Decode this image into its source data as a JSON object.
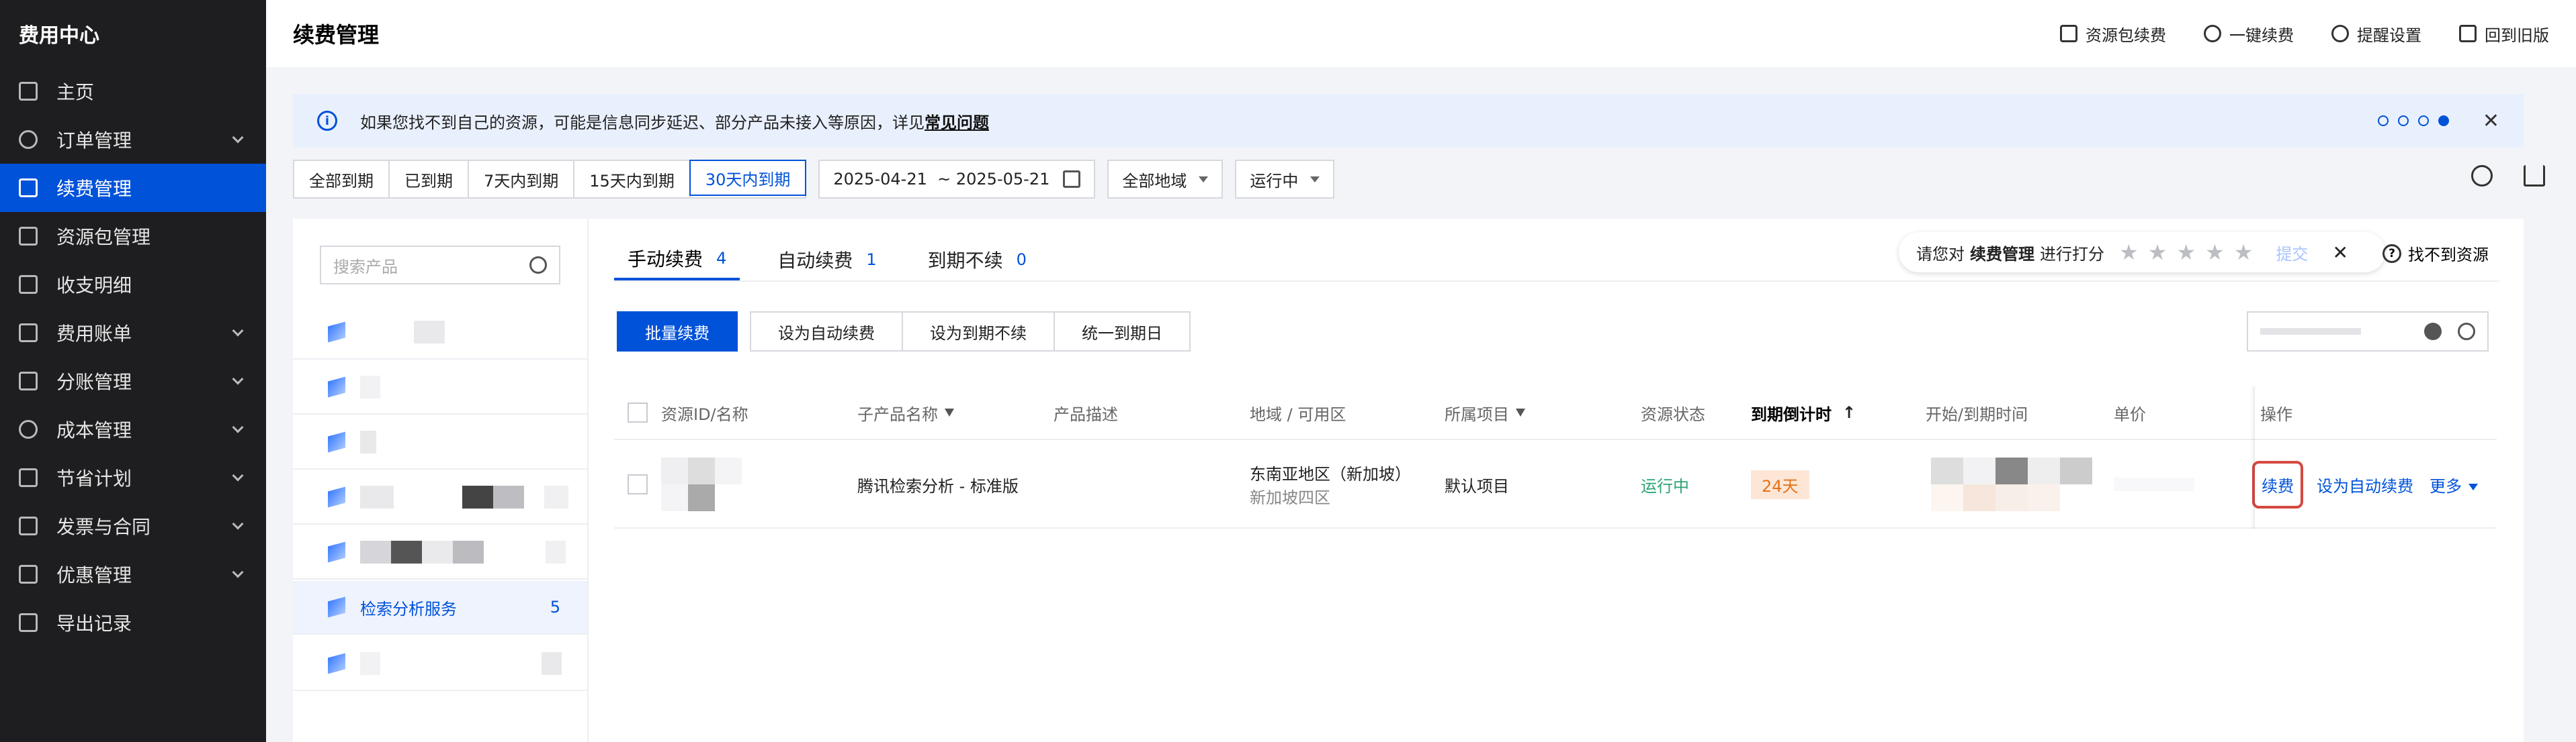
{
  "sidebar": {
    "brand": "费用中心",
    "items": [
      {
        "label": "主页",
        "icon": "dashboard-icon",
        "expandable": false
      },
      {
        "label": "订单管理",
        "icon": "order-icon",
        "expandable": true
      },
      {
        "label": "续费管理",
        "icon": "renew-icon",
        "expandable": false,
        "active": true
      },
      {
        "label": "资源包管理",
        "icon": "package-icon",
        "expandable": false
      },
      {
        "label": "收支明细",
        "icon": "ledger-icon",
        "expandable": false
      },
      {
        "label": "费用账单",
        "icon": "bill-icon",
        "expandable": true
      },
      {
        "label": "分账管理",
        "icon": "split-icon",
        "expandable": true
      },
      {
        "label": "成本管理",
        "icon": "pie-icon",
        "expandable": true
      },
      {
        "label": "节省计划",
        "icon": "plan-icon",
        "expandable": true
      },
      {
        "label": "发票与合同",
        "icon": "invoice-icon",
        "expandable": true
      },
      {
        "label": "优惠管理",
        "icon": "coupon-icon",
        "expandable": true
      },
      {
        "label": "导出记录",
        "icon": "export-icon",
        "expandable": false
      }
    ]
  },
  "header": {
    "title": "续费管理",
    "actions": [
      {
        "label": "资源包续费",
        "icon": "cube-icon"
      },
      {
        "label": "一键续费",
        "icon": "yen-icon"
      },
      {
        "label": "提醒设置",
        "icon": "bell-icon"
      },
      {
        "label": "回到旧版",
        "icon": "switch-icon"
      }
    ]
  },
  "notice": {
    "text": "如果您找不到自己的资源，可能是信息同步延迟、部分产品未接入等原因，详见",
    "link": "常见问题",
    "info_glyph": "i",
    "close_glyph": "✕"
  },
  "filters": {
    "periods": [
      "全部到期",
      "已到期",
      "7天内到期",
      "15天内到期",
      "30天内到期"
    ],
    "selected_period": "30天内到期",
    "date_start": "2025-04-21",
    "date_sep": "~",
    "date_end": "2025-05-21",
    "region": "全部地域",
    "status": "运行中"
  },
  "products": {
    "search_placeholder": "搜索产品",
    "active_label": "检索分析服务",
    "active_count": "5"
  },
  "tabs": [
    {
      "label": "手动续费",
      "count": "4",
      "active": true
    },
    {
      "label": "自动续费",
      "count": "1",
      "active": false
    },
    {
      "label": "到期不续",
      "count": "0",
      "active": false
    }
  ],
  "rating": {
    "prefix": "请您对",
    "subject": "续费管理",
    "suffix": "进行打分",
    "stars": "★★★★★",
    "submit": "提交",
    "close": "✕"
  },
  "not_found": {
    "label": "找不到资源",
    "glyph": "?"
  },
  "actions": {
    "batch": "批量续费",
    "set_auto": "设为自动续费",
    "set_no_renew": "设为到期不续",
    "unify_date": "统一到期日"
  },
  "table": {
    "headers": {
      "id": "资源ID/名称",
      "subproduct": "子产品名称",
      "desc": "产品描述",
      "region": "地域 / 可用区",
      "project": "所属项目",
      "state": "资源状态",
      "countdown": "到期倒计时",
      "sort_glyph": "↑",
      "time": "开始/到期时间",
      "price": "单价",
      "ops": "操作"
    },
    "rows": [
      {
        "subproduct": "腾讯检索分析 - 标准版",
        "region": "东南亚地区（新加坡）",
        "zone": "新加坡四区",
        "project": "默认项目",
        "state": "运行中",
        "countdown": "24天",
        "op_renew": "续费",
        "op_auto": "设为自动续费",
        "op_more": "更多"
      }
    ]
  },
  "colors": {
    "primary": "#0052d9",
    "sidebar_bg": "#1e1e20",
    "running": "#2ba471",
    "warn_bg": "#fde6d6",
    "warn_text": "#e37318",
    "highlight": "#d54941"
  }
}
